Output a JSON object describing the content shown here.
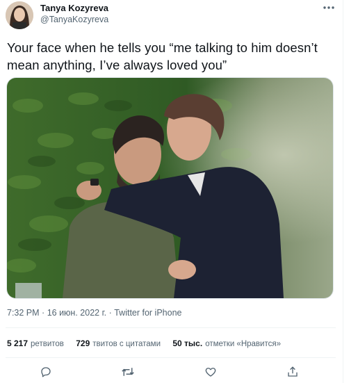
{
  "author": {
    "name": "Tanya Kozyreva",
    "handle": "@TanyaKozyreva"
  },
  "tweet": {
    "text": "Your face when he tells you “me talking to him doesn’t mean anything, I’ve always loved you”"
  },
  "meta": {
    "time": "7:32 PM",
    "separator": "·",
    "date": "16 июн. 2022 г.",
    "source": "Twitter for iPhone"
  },
  "stats": {
    "retweets_count": "5 217",
    "retweets_label": "ретвитов",
    "quotes_count": "729",
    "quotes_label": "твитов с цитатами",
    "likes_count": "50 тыс.",
    "likes_label": "отметки «Нравится»"
  },
  "icons": {
    "more": "more-horizontal-icon",
    "reply": "reply-icon",
    "retweet": "retweet-icon",
    "like": "heart-icon",
    "share": "share-icon"
  },
  "colors": {
    "text": "#0f1419",
    "secondary": "#536471",
    "divider": "#eff3f4"
  }
}
